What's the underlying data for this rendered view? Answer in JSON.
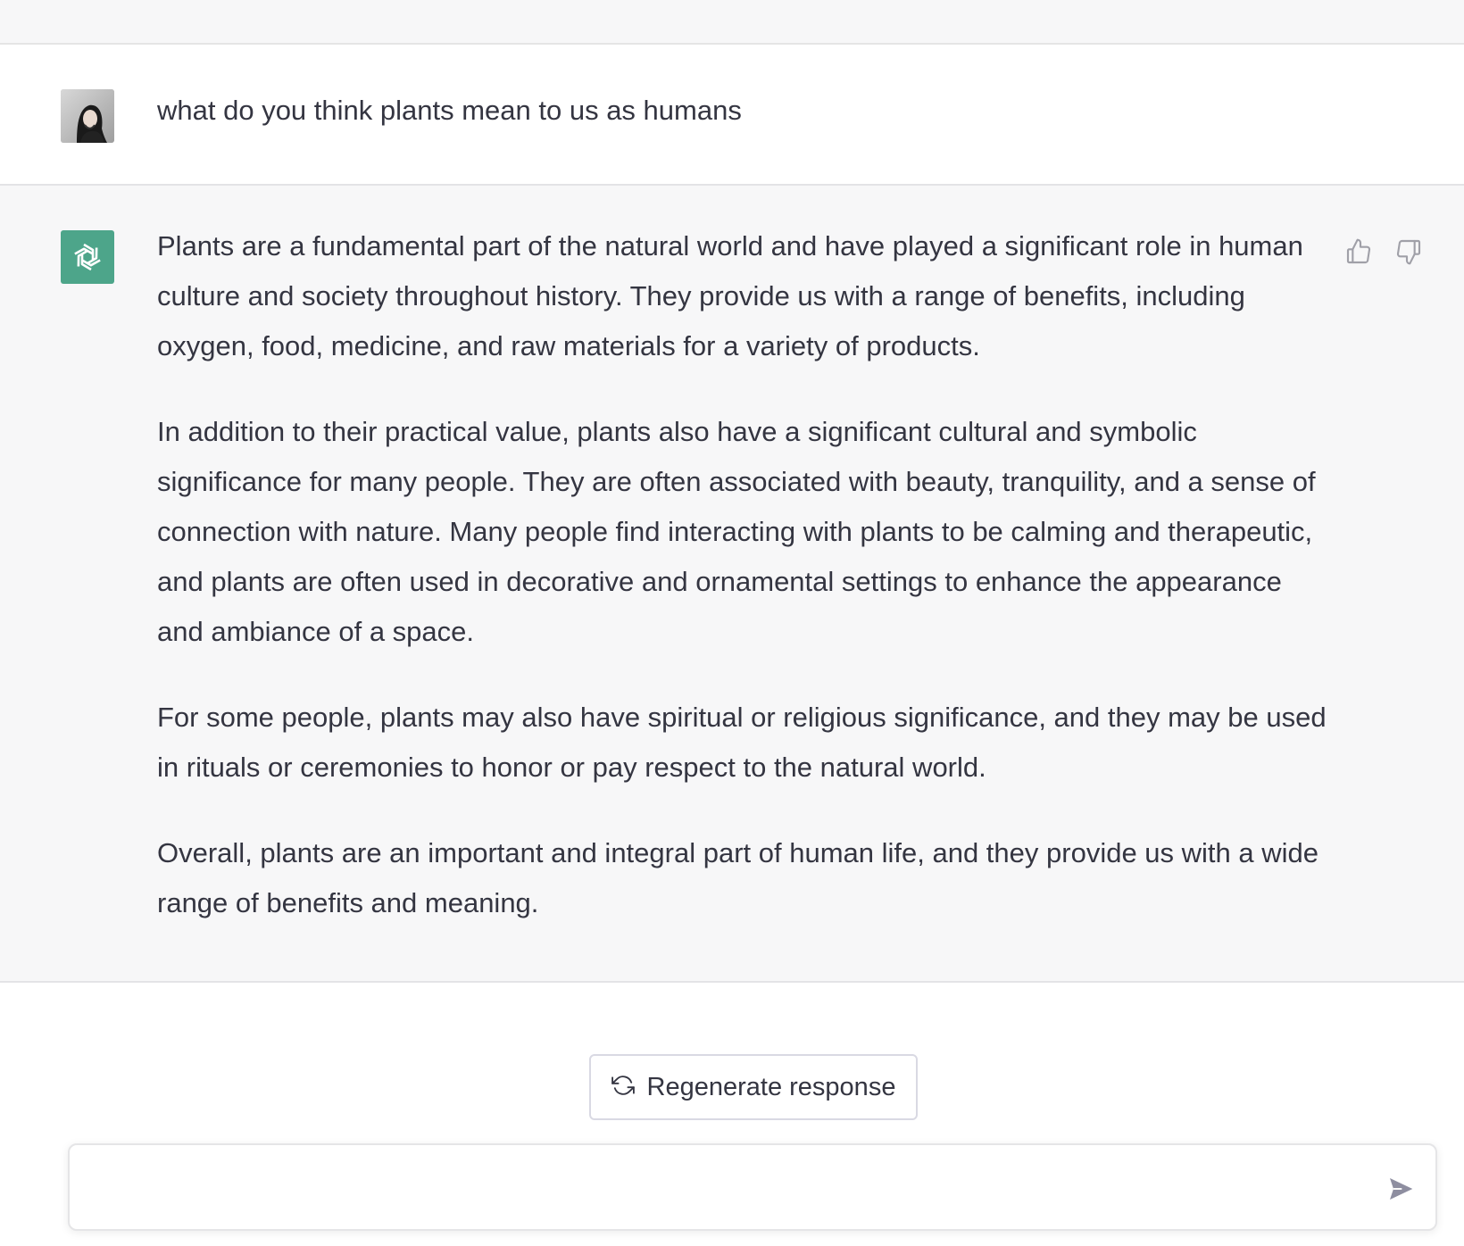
{
  "conversation": {
    "user_message": {
      "avatar": "user-photo-avatar",
      "text": "what do you think plants mean to us as humans"
    },
    "assistant_message": {
      "avatar": "openai-logo-icon",
      "paragraphs": [
        "Plants are a fundamental part of the natural world and have played a significant role in human culture and society throughout history. They provide us with a range of benefits, including oxygen, food, medicine, and raw materials for a variety of products.",
        "In addition to their practical value, plants also have a significant cultural and symbolic significance for many people. They are often associated with beauty, tranquility, and a sense of connection with nature. Many people find interacting with plants to be calming and therapeutic, and plants are often used in decorative and ornamental settings to enhance the appearance and ambiance of a space.",
        "For some people, plants may also have spiritual or religious significance, and they may be used in rituals or ceremonies to honor or pay respect to the natural world.",
        "Overall, plants are an important and integral part of human life, and they provide us with a wide range of benefits and meaning."
      ],
      "feedback_icons": [
        "thumbs-up-icon",
        "thumbs-down-icon"
      ]
    }
  },
  "actions": {
    "regenerate_label": "Regenerate response",
    "regenerate_icon": "refresh-icon"
  },
  "composer": {
    "value": "",
    "send_icon": "send-icon"
  },
  "colors": {
    "bot_avatar_bg": "#4da58a",
    "assistant_row_bg": "#f7f7f8",
    "text": "#343541"
  }
}
